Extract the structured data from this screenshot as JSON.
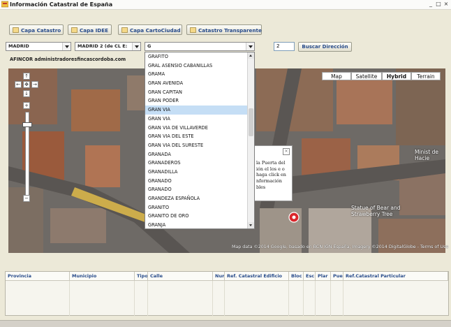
{
  "window": {
    "title": "Información Catastral de España",
    "buttons": [
      "_",
      "□",
      "×"
    ]
  },
  "toolbar": {
    "buttons": [
      "Capa Catastro",
      "Capa IDEE",
      "Capa CartoCiudad",
      "Catastro Transparente"
    ]
  },
  "search": {
    "provincia": "MADRID",
    "municipio": "MADRID 2 (de CL E:",
    "calle": "G",
    "numero": "2",
    "buscar_label": "Buscar Dirección"
  },
  "company_label": "AFINCOR administradoresfincascordoba.com",
  "map": {
    "types": [
      "Map",
      "Satellite",
      "Hybrid",
      "Terrain"
    ],
    "active_type": "Hybrid",
    "infowindow_text": "la Puerta del ión el los e o haga click en nformación bles",
    "labels": [
      "Minist de Hacie",
      "Statue of Bear and Strawberry Tree"
    ],
    "attribution": "Map data ©2014 Google, basado en BCN IGN España, Imagery ©2014 DigitalGlobe - Terms of Use"
  },
  "street_dropdown": {
    "items": [
      "GRAFITO",
      "GRAL ASENSIO CABANILLAS",
      "GRAMA",
      "GRAN AVENIDA",
      "GRAN CAPITAN",
      "GRAN PODER",
      "GRAN VIA",
      "GRAN VIA",
      "GRAN VIA DE VILLAVERDE",
      "GRAN VIA DEL ESTE",
      "GRAN VIA DEL SURESTE",
      "GRANADA",
      "GRANADEROS",
      "GRANADILLA",
      "GRANADO",
      "GRANADO",
      "GRANDEZA ESPAÑOLA",
      "GRANITO",
      "GRANITO DE ORO",
      "GRANJA"
    ],
    "selected_index": 6
  },
  "results_table": {
    "headers": [
      "Provincia",
      "Municipio",
      "Tipo",
      "Calle",
      "Num",
      "Ref. Catastral Edificio",
      "Bloc",
      "Esc",
      "Plar",
      "Pue",
      "Ref.Catastral Particular"
    ]
  },
  "colors": {
    "accent": "#274b8a",
    "window_bg": "#ece9d8",
    "selection": "#c5def5"
  }
}
